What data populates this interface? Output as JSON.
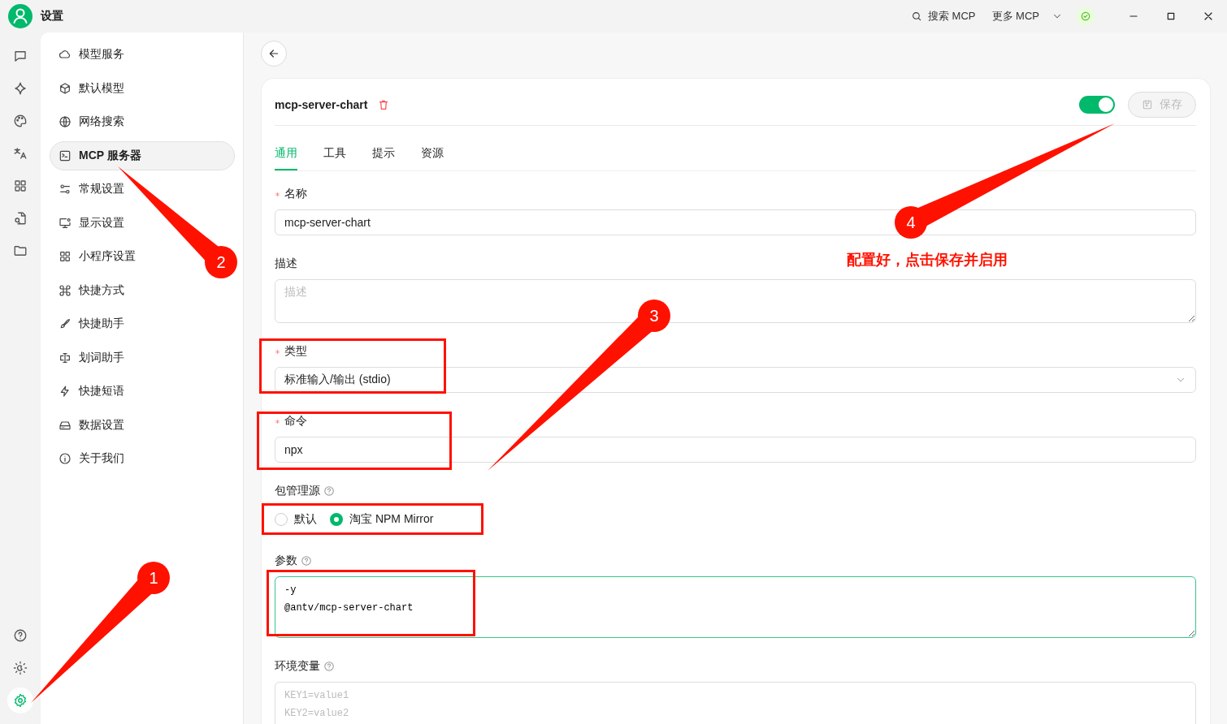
{
  "window": {
    "title": "设置",
    "actions": [
      {
        "kind": "search",
        "label": "搜索 MCP"
      },
      {
        "kind": "dropdown",
        "label": "更多 MCP"
      },
      {
        "kind": "status"
      }
    ]
  },
  "rail": {
    "top": [
      {
        "selected": false
      },
      {
        "selected": false
      },
      {
        "selected": false
      },
      {
        "selected": false
      },
      {
        "selected": false
      },
      {
        "selected": false
      },
      {
        "selected": false
      }
    ],
    "bottom": [
      {
        "selected": false
      },
      {
        "selected": false
      },
      {
        "selected": true
      }
    ]
  },
  "sidebar": {
    "items": [
      {
        "label": "模型服务",
        "selected": false
      },
      {
        "label": "默认模型",
        "selected": false
      },
      {
        "label": "网络搜索",
        "selected": false
      },
      {
        "label": "MCP 服务器",
        "selected": true
      },
      {
        "label": "常规设置",
        "selected": false
      },
      {
        "label": "显示设置",
        "selected": false
      },
      {
        "label": "小程序设置",
        "selected": false
      },
      {
        "label": "快捷方式",
        "selected": false
      },
      {
        "label": "快捷助手",
        "selected": false
      },
      {
        "label": "划词助手",
        "selected": false
      },
      {
        "label": "快捷短语",
        "selected": false
      },
      {
        "label": "数据设置",
        "selected": false
      },
      {
        "label": "关于我们",
        "selected": false
      }
    ]
  },
  "server": {
    "name": "mcp-server-chart",
    "enabled": true,
    "save_button": {
      "label": "保存",
      "disabled": true
    }
  },
  "tabs": [
    {
      "label": "通用",
      "selected": true
    },
    {
      "label": "工具",
      "selected": false
    },
    {
      "label": "提示",
      "selected": false
    },
    {
      "label": "资源",
      "selected": false
    }
  ],
  "form": [
    {
      "kind": "input",
      "label": "名称",
      "required": true,
      "help": false,
      "value": "mcp-server-chart"
    },
    {
      "kind": "textarea",
      "label": "描述",
      "required": false,
      "help": false,
      "placeholder": "描述",
      "focused": false
    },
    {
      "kind": "select",
      "label": "类型",
      "required": true,
      "help": false,
      "value": "标准输入/输出 (stdio)"
    },
    {
      "kind": "input",
      "label": "命令",
      "required": true,
      "help": false,
      "value": "npx"
    },
    {
      "kind": "radio",
      "label": "包管理源",
      "required": false,
      "help": true,
      "options": [
        {
          "label": "默认",
          "selected": false
        },
        {
          "label": "淘宝 NPM Mirror",
          "selected": true
        }
      ]
    },
    {
      "kind": "code",
      "label": "参数",
      "required": false,
      "help": true,
      "value": "-y\n@antv/mcp-server-chart",
      "focused": true
    },
    {
      "kind": "code",
      "label": "环境变量",
      "required": false,
      "help": true,
      "placeholder": "KEY1=value1\nKEY2=value2",
      "focused": false
    }
  ],
  "annotations": {
    "note": "配置好，点击保存并启用",
    "frames": [
      {
        "kind": "frame"
      },
      {
        "kind": "frame"
      },
      {
        "kind": "frame"
      },
      {
        "kind": "frame"
      }
    ],
    "arrows": [
      {
        "label": "1"
      },
      {
        "label": "2"
      },
      {
        "label": "3"
      },
      {
        "label": "4"
      }
    ]
  }
}
